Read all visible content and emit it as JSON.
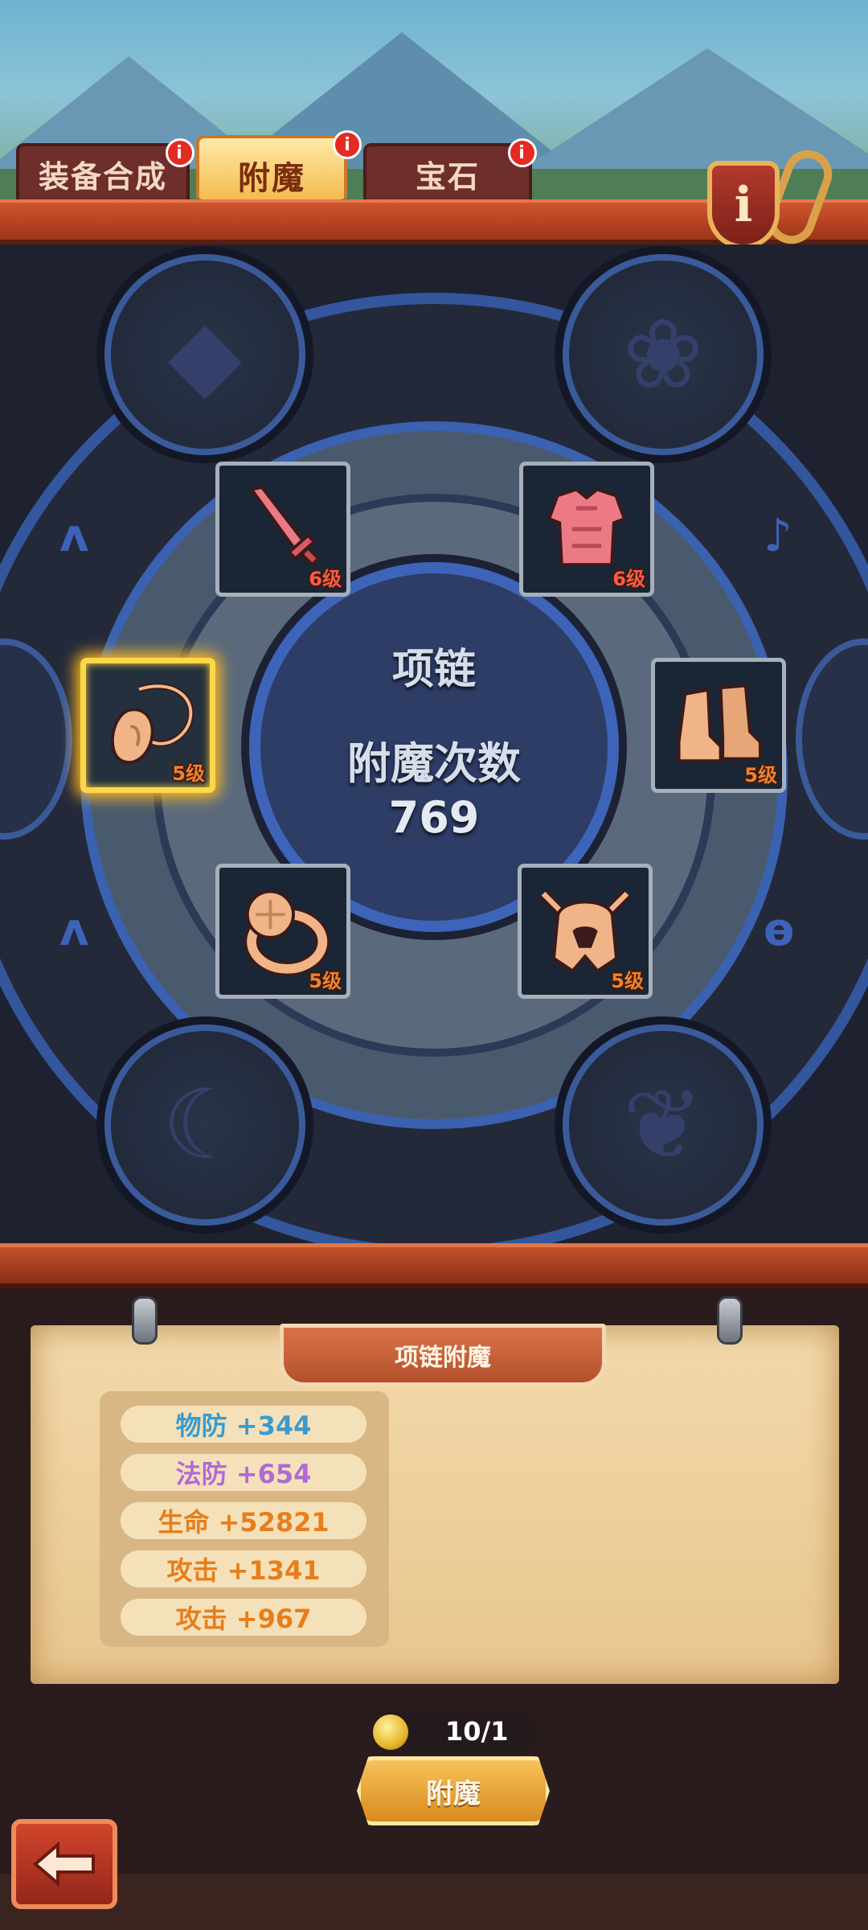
{
  "tabs": [
    {
      "label": "装备合成",
      "badge": "i",
      "active": false
    },
    {
      "label": "附魔",
      "badge": "i",
      "active": true
    },
    {
      "label": "宝石",
      "badge": "i",
      "active": false
    }
  ],
  "info_button": {
    "label": "i",
    "icon": "info-shield-icon"
  },
  "equipment": [
    {
      "name": "sword",
      "icon": "sword-icon",
      "level": "6级",
      "selected": false
    },
    {
      "name": "chest-armor",
      "icon": "armor-icon",
      "level": "6级",
      "selected": false
    },
    {
      "name": "necklace",
      "icon": "necklace-icon",
      "level": "5级",
      "selected": true
    },
    {
      "name": "boots",
      "icon": "boots-icon",
      "level": "5级",
      "selected": false
    },
    {
      "name": "ring",
      "icon": "ring-icon",
      "level": "5级",
      "selected": false
    },
    {
      "name": "helmet",
      "icon": "helmet-icon",
      "level": "5级",
      "selected": false
    }
  ],
  "center": {
    "item_name": "项链",
    "label": "附魔次数",
    "count": "769"
  },
  "panel": {
    "title": "项链附魔",
    "stats": [
      {
        "text": "物防 +344",
        "color": "#3a9bcf"
      },
      {
        "text": "法防 +654",
        "color": "#b06ad8"
      },
      {
        "text": "生命 +52821",
        "color": "#e67e1c"
      },
      {
        "text": "攻击 +1341",
        "color": "#e67e1c"
      },
      {
        "text": "攻击 +967",
        "color": "#e67e1c"
      }
    ]
  },
  "cost": {
    "icon": "gold-coin-icon",
    "text": "10/1"
  },
  "action_button": {
    "label": "附魔"
  },
  "back_button": {
    "icon": "back-arrow-icon"
  }
}
